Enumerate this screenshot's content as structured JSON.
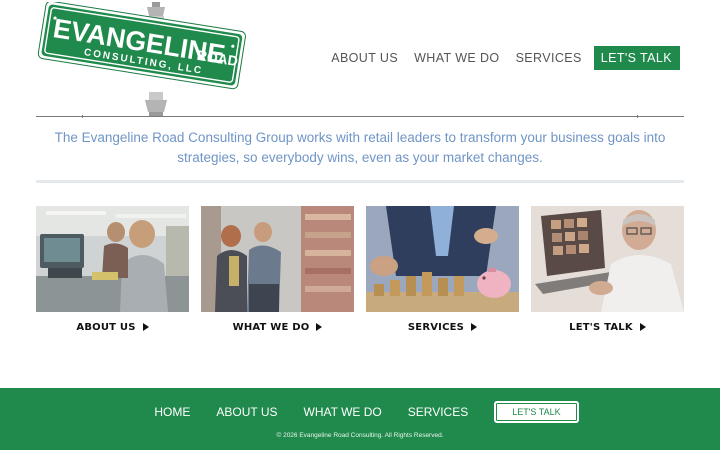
{
  "logo": {
    "line1_left": "EVANGELINE",
    "line1_right": "ROAD",
    "line2": "CONSULTING, LLC"
  },
  "nav": {
    "items": [
      {
        "label": "ABOUT US"
      },
      {
        "label": "WHAT WE DO"
      },
      {
        "label": "SERVICES"
      }
    ],
    "cta": "LET'S TALK"
  },
  "intro": "The Evangeline Road Consulting Group works with retail leaders to transform your business goals into strategies, so everybody wins, even as your market changes.",
  "cards": [
    {
      "label": "ABOUT US",
      "image": "checkout-counter-photo"
    },
    {
      "label": "WHAT WE DO",
      "image": "store-aisle-photo"
    },
    {
      "label": "SERVICES",
      "image": "coins-piggy-bank-photo"
    },
    {
      "label": "LET'S TALK",
      "image": "video-call-laptop-photo"
    }
  ],
  "footer": {
    "items": [
      {
        "label": "HOME"
      },
      {
        "label": "ABOUT US"
      },
      {
        "label": "WHAT WE DO"
      },
      {
        "label": "SERVICES"
      }
    ],
    "cta": "LET'S TALK",
    "copyright": "© 2026 Evangeline Road Consulting. All Rights Reserved."
  },
  "colors": {
    "brand_green": "#1f8a4c",
    "intro_blue": "#6f95c6",
    "footer_bg": "#1f8a4c"
  }
}
